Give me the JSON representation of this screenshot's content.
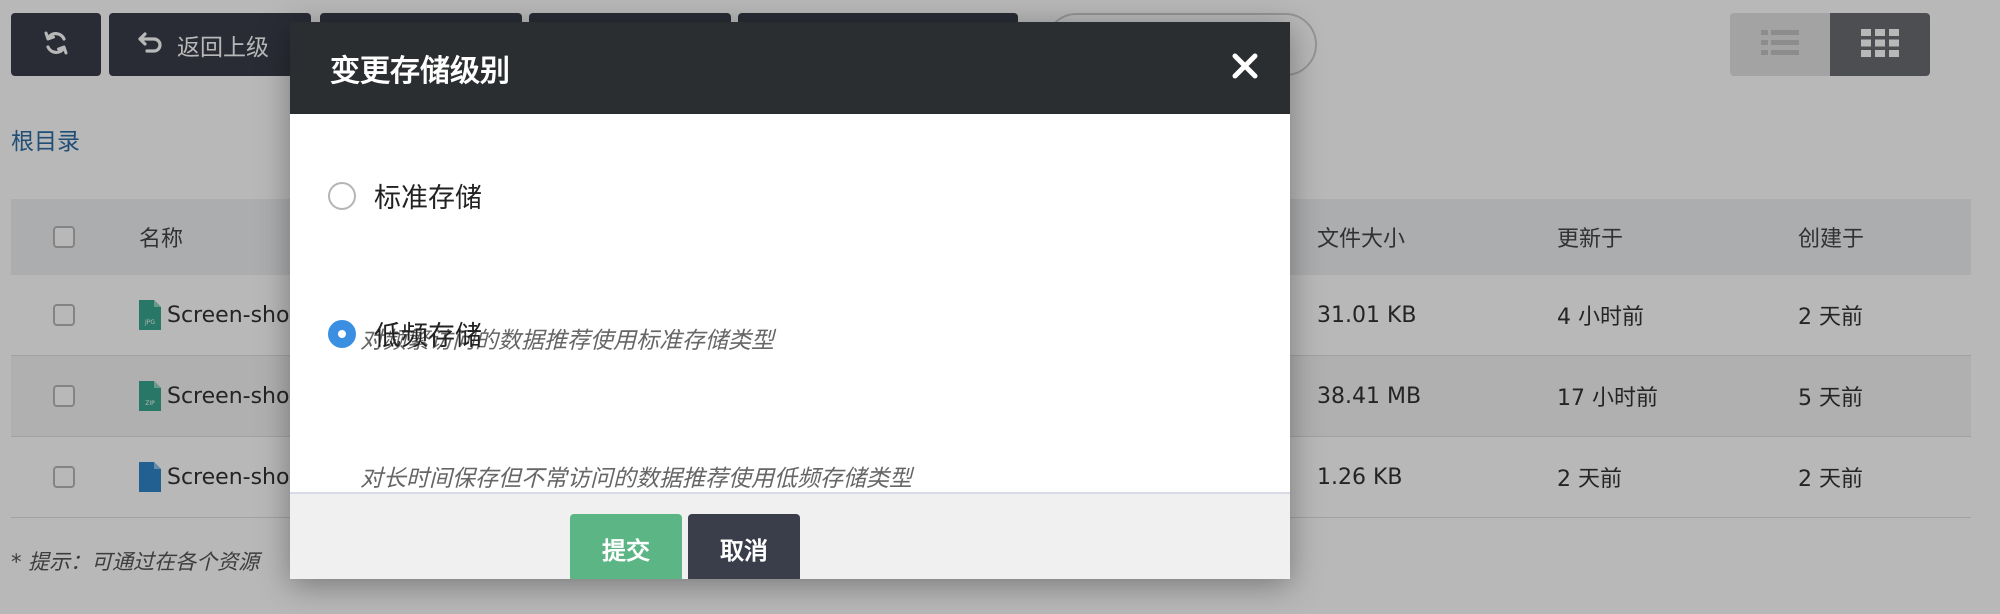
{
  "toolbar": {
    "back_label": "返回上级",
    "refresh_icon": "refresh-icon",
    "back_icon": "return-arrow-icon",
    "list_view_icon": "list-view-icon",
    "grid_view_icon": "grid-view-icon"
  },
  "breadcrumb": {
    "root": "根目录"
  },
  "table": {
    "columns": {
      "name": "名称",
      "size": "文件大小",
      "updated": "更新于",
      "created": "创建于"
    },
    "rows": [
      {
        "name": "Screen-sho",
        "icon": "jpg-file-icon",
        "icon_label": "JPG",
        "size": "31.01 KB",
        "updated": "4 小时前",
        "created": "2 天前"
      },
      {
        "name": "Screen-sho",
        "icon": "zip-file-icon",
        "icon_label": "ZIP",
        "size": "38.41 MB",
        "updated": "17 小时前",
        "created": "5 天前"
      },
      {
        "name": "Screen-sho",
        "icon": "file-icon",
        "icon_label": "",
        "size": "1.26 KB",
        "updated": "2 天前",
        "created": "2 天前"
      }
    ]
  },
  "hint": "* 提示：可通过在各个资源",
  "modal": {
    "title": "变更存储级别",
    "options": [
      {
        "label": "标准存储",
        "description": "对频繁访问的数据推荐使用标准存储类型",
        "selected": false
      },
      {
        "label": "低频存储",
        "description": "对长时间保存但不常访问的数据推荐使用低频存储类型",
        "selected": true
      }
    ],
    "submit_label": "提交",
    "cancel_label": "取消"
  },
  "colors": {
    "dark_button": "#3a3d4a",
    "modal_header": "#2b2e30",
    "submit_green": "#5cb584",
    "radio_blue": "#3b8fe3",
    "link_blue": "#2e6da4"
  }
}
